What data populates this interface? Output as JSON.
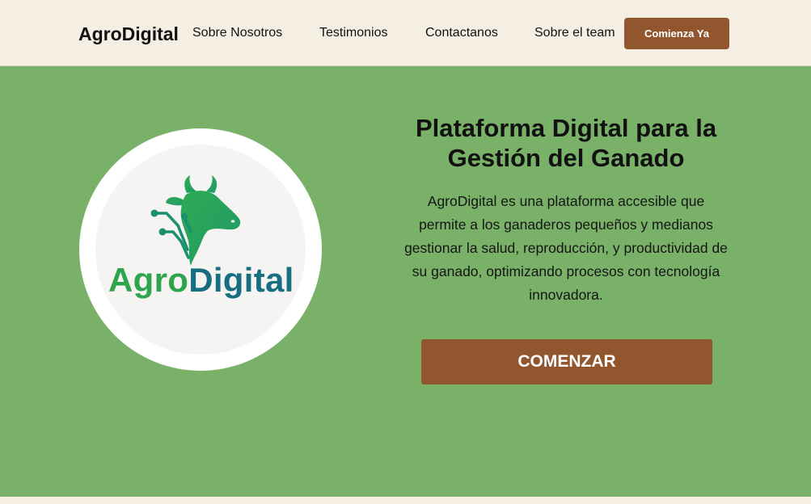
{
  "navbar": {
    "brand": "AgroDigital",
    "links": [
      "Sobre Nosotros",
      "Testimonios",
      "Contactanos",
      "Sobre el team"
    ],
    "cta_label": "Comienza Ya"
  },
  "hero": {
    "logo": {
      "text_part1": "Agro",
      "text_part2": "Digital",
      "icon": "cow-circuit-icon",
      "colors": {
        "green": "#2ea44f",
        "teal": "#156f80"
      }
    },
    "title": "Plataforma Digital para la Gestión del Ganado",
    "description": "AgroDigital es una plataforma accesible que permite a los ganaderos pequeños y medianos gestionar la salud, reproducción, y productividad de su ganado, optimizando procesos con tecnología innovadora.",
    "cta_label": "COMENZAR"
  },
  "colors": {
    "background": "#f4eee3",
    "hero_green": "#7ab168",
    "button_brown": "#92562f"
  }
}
